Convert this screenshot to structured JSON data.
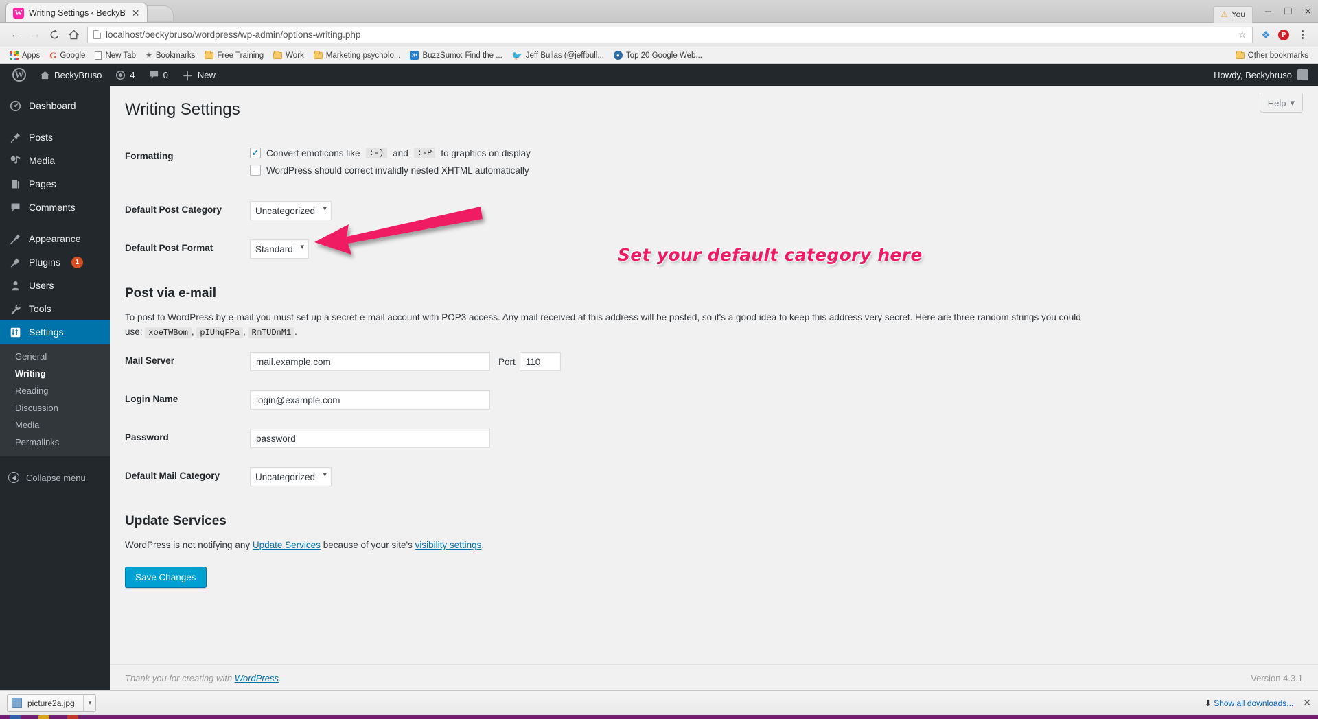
{
  "browser": {
    "tab": {
      "title": "Writing Settings ‹ BeckyB",
      "favicon": "W",
      "close": "✕"
    },
    "window_controls": {
      "minimize": "─",
      "maximize": "❐",
      "close": "✕"
    },
    "you_chip": {
      "warn_icon": "⚠",
      "label": "You"
    },
    "nav": {
      "back": "←",
      "forward": "→",
      "reload": "C",
      "home": "⌂"
    },
    "omnibox": {
      "url": "localhost/beckybruso/wordpress/wp-admin/options-writing.php",
      "star_icon": "☆",
      "page_icon": "page-icon"
    },
    "extensions": [
      {
        "name": "layers-extension-icon",
        "glyph": "❖"
      },
      {
        "name": "pinterest-extension-icon",
        "glyph": "P"
      }
    ],
    "bookmarks": [
      {
        "label": "Apps",
        "icon": "apps-grid"
      },
      {
        "label": "Google",
        "icon": "google"
      },
      {
        "label": "New Tab",
        "icon": "doc"
      },
      {
        "label": "Bookmarks",
        "icon": "star"
      },
      {
        "label": "Free Training",
        "icon": "folder"
      },
      {
        "label": "Work",
        "icon": "folder"
      },
      {
        "label": "Marketing psycholo...",
        "icon": "folder"
      },
      {
        "label": "BuzzSumo: Find the ...",
        "icon": "rss"
      },
      {
        "label": "Jeff Bullas (@jeffbull...",
        "icon": "twitter"
      },
      {
        "label": "Top 20 Google Web...",
        "icon": "circle"
      }
    ],
    "other_bookmarks": {
      "label": "Other bookmarks",
      "icon": "folder"
    }
  },
  "adminbar": {
    "wp_logo": "W",
    "site_name": "BeckyBruso",
    "home_icon": "⌂",
    "updates": {
      "icon": "↻",
      "count": "4"
    },
    "comments": {
      "icon": "💬",
      "count": "0"
    },
    "new": {
      "icon": "+",
      "label": "New"
    },
    "howdy": "Howdy, Beckybruso"
  },
  "sidebar": {
    "items": [
      {
        "label": "Dashboard",
        "icon": "dashboard-icon",
        "glyph": "◔"
      },
      {
        "label": "Posts",
        "icon": "pin-icon",
        "glyph": "📌"
      },
      {
        "label": "Media",
        "icon": "media-icon",
        "glyph": "🎵"
      },
      {
        "label": "Pages",
        "icon": "pages-icon",
        "glyph": "📄"
      },
      {
        "label": "Comments",
        "icon": "comments-icon",
        "glyph": "💬"
      },
      {
        "label": "Appearance",
        "icon": "brush-icon",
        "glyph": "🖌"
      },
      {
        "label": "Plugins",
        "icon": "plug-icon",
        "glyph": "🔌",
        "badge": "1"
      },
      {
        "label": "Users",
        "icon": "user-icon",
        "glyph": "👤"
      },
      {
        "label": "Tools",
        "icon": "wrench-icon",
        "glyph": "🔧"
      },
      {
        "label": "Settings",
        "icon": "sliders-icon",
        "glyph": "⇅",
        "current": true
      }
    ],
    "submenu": [
      {
        "label": "General"
      },
      {
        "label": "Writing",
        "current": true
      },
      {
        "label": "Reading"
      },
      {
        "label": "Discussion"
      },
      {
        "label": "Media"
      },
      {
        "label": "Permalinks"
      }
    ],
    "collapse": {
      "label": "Collapse menu",
      "icon": "collapse-icon",
      "glyph": "◀"
    }
  },
  "page": {
    "help_tab": {
      "label": "Help",
      "caret": "▾"
    },
    "title": "Writing Settings",
    "formatting": {
      "row_label": "Formatting",
      "emoticons": {
        "checked": true,
        "check_glyph": "✓",
        "text_before": "Convert emoticons like",
        "code1": ":-)",
        "text_mid": "and",
        "code2": ":-P",
        "text_after": "to graphics on display"
      },
      "xhtml": {
        "checked": false,
        "label": "WordPress should correct invalidly nested XHTML automatically"
      }
    },
    "default_post_category": {
      "row_label": "Default Post Category",
      "value": "Uncategorized",
      "options": [
        "Uncategorized"
      ]
    },
    "default_post_format": {
      "row_label": "Default Post Format",
      "value": "Standard",
      "options": [
        "Standard"
      ]
    },
    "post_via_email": {
      "heading": "Post via e-mail",
      "description_1": "To post to WordPress by e-mail you must set up a secret e-mail account with POP3 access. Any mail received at this address will be posted, so it's a good idea to keep this address very secret. Here are three random strings you could use:",
      "random_strings": [
        "xoeTWBom",
        "pIUhqFPa",
        "RmTUDnM1"
      ],
      "description_end": ".",
      "mail_server": {
        "row_label": "Mail Server",
        "value": "mail.example.com",
        "port_label": "Port",
        "port_value": "110"
      },
      "login_name": {
        "row_label": "Login Name",
        "value": "login@example.com"
      },
      "password": {
        "row_label": "Password",
        "value": "password"
      },
      "default_mail_category": {
        "row_label": "Default Mail Category",
        "value": "Uncategorized",
        "options": [
          "Uncategorized"
        ]
      }
    },
    "update_services": {
      "heading": "Update Services",
      "text_before": "WordPress is not notifying any",
      "link_1": "Update Services",
      "text_mid": "because of your site's",
      "link_2": "visibility settings",
      "text_after": "."
    },
    "save_button": "Save Changes",
    "footer": {
      "thanks_before": "Thank you for creating with",
      "thanks_link": "WordPress",
      "thanks_after": ".",
      "version": "Version 4.3.1"
    }
  },
  "annotation": {
    "text": "Set your default category here",
    "color": "#ef1a63",
    "arrow": "arrow pointing left to Default Post Category dropdown"
  },
  "downloads_bar": {
    "item": {
      "filename": "picture2a.jpg",
      "caret": "▾"
    },
    "show_all": {
      "icon": "⬇",
      "label": "Show all downloads..."
    },
    "close": "✕"
  }
}
